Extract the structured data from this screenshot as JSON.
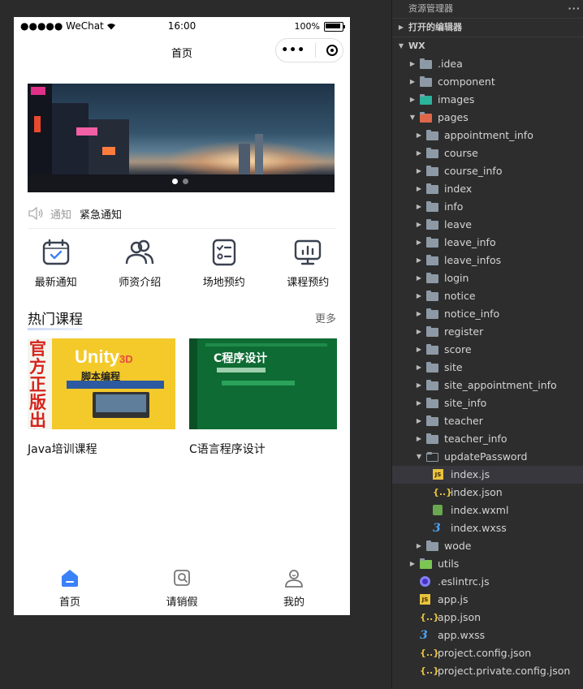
{
  "simulator": {
    "status_bar": {
      "carrier": "●●●●● WeChat",
      "time": "16:00",
      "battery": "100%"
    },
    "nav_title": "首页",
    "capsule_menu": "•••",
    "banner": {
      "dots": 2,
      "active_dot": 0
    },
    "notice": {
      "tag": "通知",
      "text": "紧急通知"
    },
    "grid": [
      {
        "label": "最新通知",
        "icon": "calendar-check-icon"
      },
      {
        "label": "师资介绍",
        "icon": "users-icon"
      },
      {
        "label": "场地预约",
        "icon": "checklist-icon"
      },
      {
        "label": "课程预约",
        "icon": "presentation-chart-icon"
      }
    ],
    "section": {
      "title": "热门课程",
      "more": "更多"
    },
    "courses": [
      {
        "name": "Java培训课程",
        "cover_title": "Unity",
        "cover_title_suffix": "3D",
        "cover_subtitle": "脚本编程",
        "cover_side_text": "官方正版出版社直发"
      },
      {
        "name": "C语言程序设计",
        "cover_title": "C程序设计"
      }
    ],
    "tabbar": [
      {
        "label": "首页",
        "icon": "home-icon",
        "active": true
      },
      {
        "label": "请销假",
        "icon": "leave-icon",
        "active": false
      },
      {
        "label": "我的",
        "icon": "user-icon",
        "active": false
      }
    ],
    "colors": {
      "active_tab": "#3b82f6",
      "icon_stroke": "#3a4150"
    }
  },
  "explorer": {
    "header": "资源管理器",
    "more": "···",
    "open_editors": "打开的编辑器",
    "root": "WX",
    "items": [
      {
        "label": ".idea",
        "type": "folder",
        "depth": 1,
        "expanded": false
      },
      {
        "label": "component",
        "type": "folder",
        "depth": 1,
        "expanded": false
      },
      {
        "label": "images",
        "type": "folder-images",
        "depth": 1,
        "expanded": false
      },
      {
        "label": "pages",
        "type": "folder-pages",
        "depth": 1,
        "expanded": true
      },
      {
        "label": "appointment_info",
        "type": "folder",
        "depth": 2,
        "expanded": false
      },
      {
        "label": "course",
        "type": "folder",
        "depth": 2,
        "expanded": false
      },
      {
        "label": "course_info",
        "type": "folder",
        "depth": 2,
        "expanded": false
      },
      {
        "label": "index",
        "type": "folder",
        "depth": 2,
        "expanded": false
      },
      {
        "label": "info",
        "type": "folder",
        "depth": 2,
        "expanded": false
      },
      {
        "label": "leave",
        "type": "folder",
        "depth": 2,
        "expanded": false
      },
      {
        "label": "leave_info",
        "type": "folder",
        "depth": 2,
        "expanded": false
      },
      {
        "label": "leave_infos",
        "type": "folder",
        "depth": 2,
        "expanded": false
      },
      {
        "label": "login",
        "type": "folder",
        "depth": 2,
        "expanded": false
      },
      {
        "label": "notice",
        "type": "folder",
        "depth": 2,
        "expanded": false
      },
      {
        "label": "notice_info",
        "type": "folder",
        "depth": 2,
        "expanded": false
      },
      {
        "label": "register",
        "type": "folder",
        "depth": 2,
        "expanded": false
      },
      {
        "label": "score",
        "type": "folder",
        "depth": 2,
        "expanded": false
      },
      {
        "label": "site",
        "type": "folder",
        "depth": 2,
        "expanded": false
      },
      {
        "label": "site_appointment_info",
        "type": "folder",
        "depth": 2,
        "expanded": false
      },
      {
        "label": "site_info",
        "type": "folder",
        "depth": 2,
        "expanded": false
      },
      {
        "label": "teacher",
        "type": "folder",
        "depth": 2,
        "expanded": false
      },
      {
        "label": "teacher_info",
        "type": "folder",
        "depth": 2,
        "expanded": false
      },
      {
        "label": "updatePassword",
        "type": "folder",
        "depth": 2,
        "expanded": true
      },
      {
        "label": "index.js",
        "type": "js",
        "depth": 3,
        "selected": true
      },
      {
        "label": "index.json",
        "type": "json",
        "depth": 3
      },
      {
        "label": "index.wxml",
        "type": "wxml",
        "depth": 3
      },
      {
        "label": "index.wxss",
        "type": "wxss",
        "depth": 3
      },
      {
        "label": "wode",
        "type": "folder",
        "depth": 2,
        "expanded": false
      },
      {
        "label": "utils",
        "type": "folder-utils",
        "depth": 1,
        "expanded": false
      },
      {
        "label": ".eslintrc.js",
        "type": "eslint",
        "depth": 1
      },
      {
        "label": "app.js",
        "type": "js",
        "depth": 1
      },
      {
        "label": "app.json",
        "type": "json",
        "depth": 1
      },
      {
        "label": "app.wxss",
        "type": "wxss",
        "depth": 1
      },
      {
        "label": "project.config.json",
        "type": "json",
        "depth": 1
      },
      {
        "label": "project.private.config.json",
        "type": "json",
        "depth": 1
      }
    ]
  }
}
